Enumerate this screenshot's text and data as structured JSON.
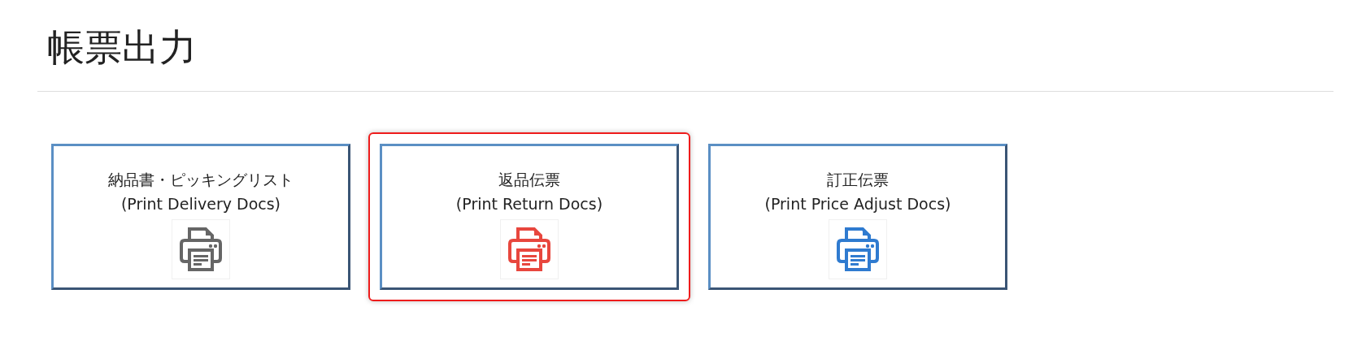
{
  "title": "帳票出力",
  "cards": [
    {
      "label": "納品書・ピッキングリスト",
      "subtitle": "(Print Delivery Docs)",
      "color": "#666666",
      "selected": false
    },
    {
      "label": "返品伝票",
      "subtitle": "(Print Return Docs)",
      "color": "#e8473e",
      "selected": true
    },
    {
      "label": "訂正伝票",
      "subtitle": "(Print Price Adjust Docs)",
      "color": "#2f7bd0",
      "selected": false
    }
  ]
}
